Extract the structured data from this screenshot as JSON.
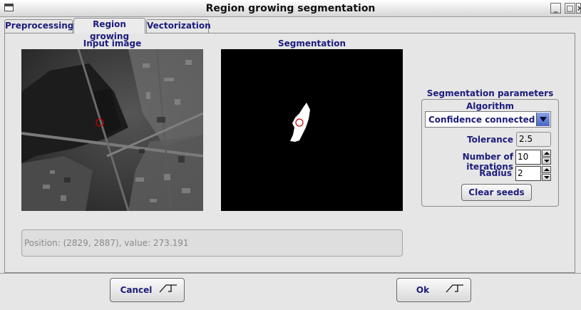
{
  "window": {
    "title": "Region growing segmentation",
    "controls": [
      "_",
      "□",
      "×"
    ]
  },
  "tabs": [
    {
      "label": "Preprocessing",
      "active": false
    },
    {
      "label": "Region growing",
      "active": true
    },
    {
      "label": "Vectorization",
      "active": false
    }
  ],
  "input_panel": {
    "caption": "Input image"
  },
  "segmentation_panel": {
    "caption": "Segmentation"
  },
  "status": {
    "text": "Position: (2829, 2887), value: 273.191"
  },
  "params": {
    "group_title": "Segmentation parameters",
    "algorithm_label": "Algorithm",
    "algorithm_value": "Confidence connected",
    "tolerance_label": "Tolerance",
    "tolerance_value": "2.5",
    "iterations_label": "Number of iterations",
    "iterations_value": "10",
    "radius_label": "Radius",
    "radius_value": "2",
    "clear_seeds_label": "Clear seeds"
  },
  "footer": {
    "cancel_label": "Cancel",
    "ok_label": "Ok"
  },
  "colors": {
    "label_blue": "#1c1c7c",
    "seed_marker": "#cc0000",
    "dropdown_blue": "#4865c2"
  }
}
